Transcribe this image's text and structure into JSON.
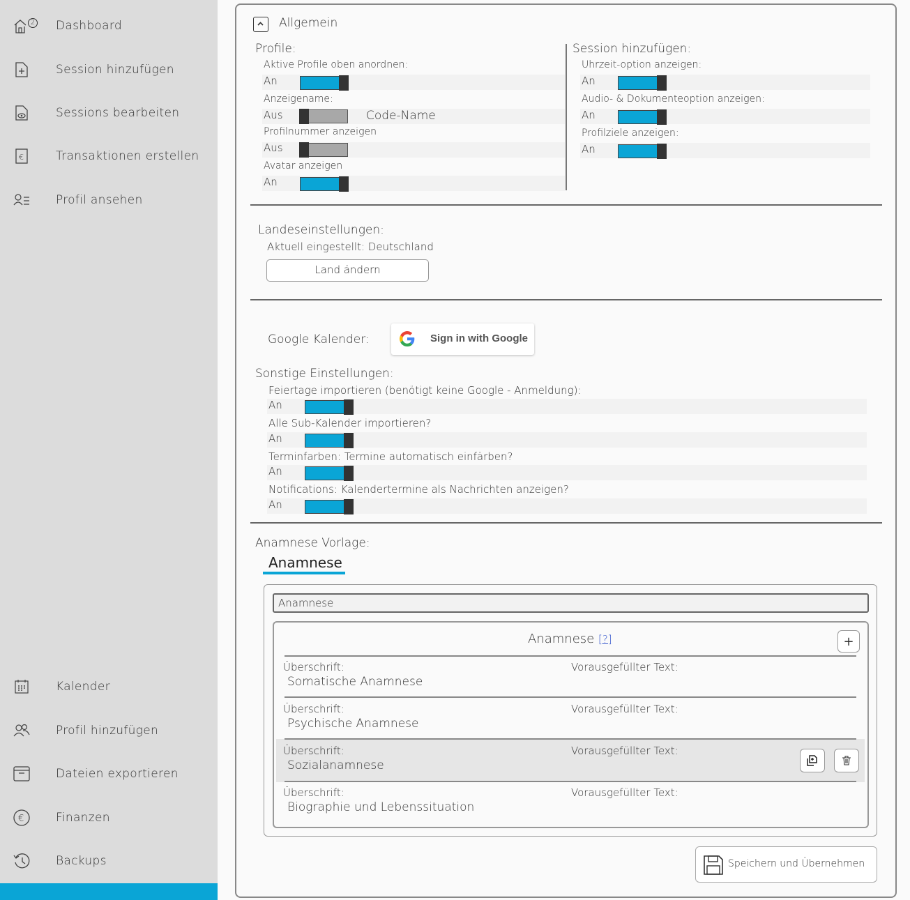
{
  "sidebar": {
    "badge": "2",
    "items": [
      {
        "label": "Dashboard"
      },
      {
        "label": "Session hinzufügen"
      },
      {
        "label": "Sessions bearbeiten"
      },
      {
        "label": "Transaktionen erstellen"
      },
      {
        "label": "Profil ansehen"
      },
      {
        "label": "Kalender"
      },
      {
        "label": "Profil hinzufügen"
      },
      {
        "label": "Dateien exportieren"
      },
      {
        "label": "Finanzen"
      },
      {
        "label": "Backups"
      }
    ],
    "accent_color": "#0aa5d6"
  },
  "allgemein": {
    "title": "Allgemein",
    "profile": {
      "heading": "Profile:",
      "aktive_profile_label": "Aktive Profile oben anordnen:",
      "aktive_profile_state": "An",
      "anzeigename_label": "Anzeigename:",
      "anzeigename_state": "Aus",
      "anzeigename_value": "Code-Name",
      "profilnummer_label": "Profilnummer anzeigen",
      "profilnummer_state": "Aus",
      "avatar_label": "Avatar anzeigen",
      "avatar_state": "An"
    },
    "session": {
      "heading": "Session hinzufügen:",
      "uhrzeit_label": "Uhrzeit-option anzeigen:",
      "uhrzeit_state": "An",
      "audio_label": "Audio- & Dokumenteoption anzeigen:",
      "audio_state": "An",
      "profilziele_label": "Profilziele anzeigen:",
      "profilziele_state": "An"
    }
  },
  "landes": {
    "heading": "Landeseinstellungen:",
    "current": "Aktuell eingestellt: Deutschland",
    "button": "Land ändern"
  },
  "google": {
    "label": "Google Kalender:",
    "button": "Sign in with Google"
  },
  "sonstige": {
    "heading": "Sonstige Einstellungen:",
    "feiertage_label": "Feiertage importieren (benötigt keine Google - Anmeldung):",
    "feiertage_state": "An",
    "subkalender_label": "Alle Sub-Kalender importieren?",
    "subkalender_state": "An",
    "terminfarben_label": "Terminfarben: Termine automatisch einfärben?",
    "terminfarben_state": "An",
    "notifications_label": "Notifications: Kalendertermine als Nachrichten anzeigen?",
    "notifications_state": "An"
  },
  "anamnese": {
    "heading": "Anamnese Vorlage:",
    "tab": "Anamnese",
    "name_value": "Anamnese",
    "table_title": "Anamnese",
    "help_link": "[?]",
    "add": "+",
    "rows": [
      {
        "ueberschrift_label": "Überschrift:",
        "ueberschrift": "Somatische Anamnese",
        "text_label": "Vorausgefüllter Text:"
      },
      {
        "ueberschrift_label": "Überschrift:",
        "ueberschrift": "Psychische Anamnese",
        "text_label": "Vorausgefüllter Text:"
      },
      {
        "ueberschrift_label": "Überschrift:",
        "ueberschrift": "Sozialanamnese",
        "text_label": "Vorausgefüllter Text:"
      },
      {
        "ueberschrift_label": "Überschrift:",
        "ueberschrift": "Biographie und Lebenssituation",
        "text_label": "Vorausgefüllter Text:"
      }
    ],
    "save_button": "Speichern und Übernehmen"
  }
}
